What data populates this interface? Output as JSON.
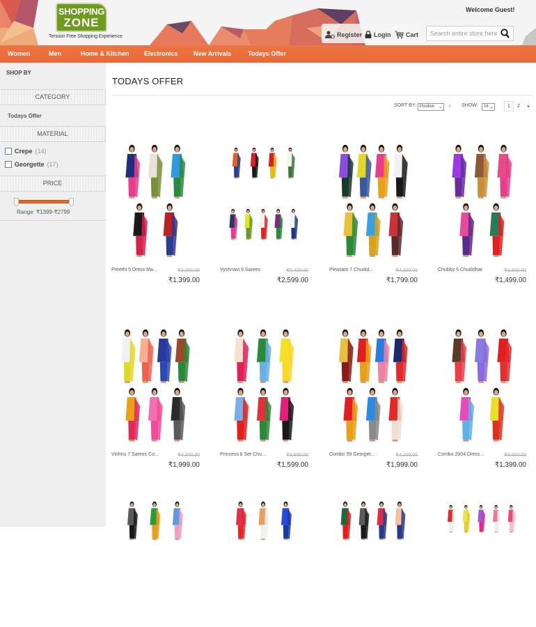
{
  "header": {
    "logo_line1": "SHOPPING",
    "logo_line2": "ZONE",
    "tagline": "Tension Free Shopping Experience",
    "welcome_prefix": "Welcome ",
    "welcome_user": "Guest!",
    "links": {
      "register": "Register",
      "login": "Login",
      "cart": "Cart"
    },
    "search_placeholder": "Search entire store here",
    "icons": {
      "register": "user-add-icon",
      "login": "lock-icon",
      "cart": "cart-icon",
      "search": "search-icon"
    }
  },
  "nav": {
    "items": [
      "Women",
      "Men",
      "Home & Kitchen",
      "Electronics",
      "New Arrivals",
      "Todays Offer"
    ]
  },
  "sidebar": {
    "shop_by": "SHOP BY",
    "category": {
      "title": "CATEGORY",
      "items": [
        "Todays Offer"
      ]
    },
    "material": {
      "title": "MATERIAL",
      "options": [
        {
          "label": "Crepe",
          "count": "(14)",
          "checked": false
        },
        {
          "label": "Georgette",
          "count": "(17)",
          "checked": false
        }
      ]
    },
    "price": {
      "title": "PRICE",
      "range_label": "Range: ₹1399-₹2799",
      "min": 1399,
      "max": 2799,
      "selected_min": 1399,
      "selected_max": 2799
    }
  },
  "main": {
    "title": "TODAYS OFFER",
    "toolbar": {
      "sort_label": "SORT BY:",
      "sort_value": "Position",
      "sort_dir_icon": "arrow-up-icon",
      "show_label": "SHOW:",
      "show_value": "16",
      "pages": [
        "1",
        "2"
      ],
      "current_page": "1",
      "next_icon": "next-page-icon"
    },
    "products": [
      {
        "name": "Preethi 5 Dress Ma...",
        "old_price": "₹3,000.00",
        "price": "₹1,399.00"
      },
      {
        "name": "Vyshnavi 9 Sarees",
        "old_price": "₹5,400.00",
        "price": "₹2,599.00"
      },
      {
        "name": "Pleasant 7 Chudid...",
        "old_price": "₹4,200.00",
        "price": "₹1,799.00"
      },
      {
        "name": "Chubby 5 Chudidhar",
        "old_price": "₹3,000.00",
        "price": "₹1,499.00"
      },
      {
        "name": "Vishnu 7 Sarees Co...",
        "old_price": "₹4,200.00",
        "price": "₹1,999.00"
      },
      {
        "name": "Princess 6 Set Chu...",
        "old_price": "₹3,600.00",
        "price": "₹1,599.00"
      },
      {
        "name": "Combo 59 Georget...",
        "old_price": "₹4,200.00",
        "price": "₹1,999.00"
      },
      {
        "name": "Combo 2004 Dress...",
        "old_price": "₹3,000.00",
        "price": "₹1,399.00"
      }
    ]
  },
  "colors": {
    "nav_orange": "#e96d3c",
    "slider_orange": "#e66a1c",
    "logo_green": "#6e9a1f",
    "sidebar_bg": "#efefef"
  }
}
